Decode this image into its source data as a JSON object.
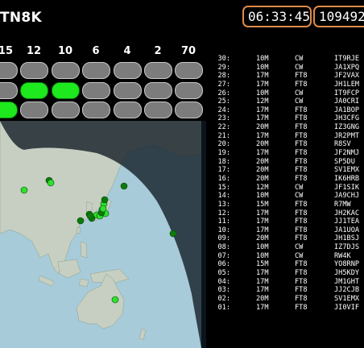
{
  "header": {
    "title": "TN8K",
    "time": "06:33:45",
    "serial": "109492"
  },
  "bands": {
    "labels": [
      "15",
      "12",
      "10",
      "6",
      "4",
      "2",
      "70"
    ],
    "rows": [
      [
        false,
        false,
        false,
        false,
        false,
        false,
        false
      ],
      [
        false,
        true,
        true,
        false,
        false,
        false,
        false
      ],
      [
        true,
        false,
        false,
        false,
        false,
        false,
        false
      ]
    ]
  },
  "colors": {
    "active": "#1ee81e",
    "inactive": "#7c7c7c",
    "accent": "#e08a4a",
    "land": "#c6cfc2",
    "water_day": "#a7cbd9",
    "water_night": "#304a57"
  },
  "map": {
    "markers": [
      {
        "shade": "light"
      },
      {
        "shade": "dark"
      },
      {
        "shade": "light"
      },
      {
        "shade": "dark"
      },
      {
        "shade": "light"
      },
      {
        "shade": "light"
      },
      {
        "shade": "dark"
      },
      {
        "shade": "light"
      },
      {
        "shade": "dark"
      },
      {
        "shade": "light"
      },
      {
        "shade": "dark"
      },
      {
        "shade": "dark"
      },
      {
        "shade": "light"
      },
      {
        "shade": "dark"
      },
      {
        "shade": "light"
      },
      {
        "shade": "dark"
      },
      {
        "shade": "dark"
      },
      {
        "shade": "light"
      }
    ]
  },
  "log": [
    {
      "num": "30:",
      "band": "10M",
      "mode": "CW",
      "call": "IT9RJE"
    },
    {
      "num": "29:",
      "band": "10M",
      "mode": "CW",
      "call": "JA1XPQ"
    },
    {
      "num": "28:",
      "band": "17M",
      "mode": "FT8",
      "call": "JF2VAX"
    },
    {
      "num": "27:",
      "band": "17M",
      "mode": "FT8",
      "call": "JH1LEM"
    },
    {
      "num": "26:",
      "band": "10M",
      "mode": "CW",
      "call": "IT9FCP"
    },
    {
      "num": "25:",
      "band": "12M",
      "mode": "CW",
      "call": "JA0CRI"
    },
    {
      "num": "24:",
      "band": "17M",
      "mode": "FT8",
      "call": "JA1BOP"
    },
    {
      "num": "23:",
      "band": "17M",
      "mode": "FT8",
      "call": "JH3CFG"
    },
    {
      "num": "22:",
      "band": "20M",
      "mode": "FT8",
      "call": "IZ3GNG"
    },
    {
      "num": "21:",
      "band": "17M",
      "mode": "FT8",
      "call": "JR2PMT"
    },
    {
      "num": "20:",
      "band": "20M",
      "mode": "FT8",
      "call": "R8SV"
    },
    {
      "num": "19:",
      "band": "17M",
      "mode": "FT8",
      "call": "JF2NMJ"
    },
    {
      "num": "18:",
      "band": "20M",
      "mode": "FT8",
      "call": "SP5DU"
    },
    {
      "num": "17:",
      "band": "20M",
      "mode": "FT8",
      "call": "SV1EMX"
    },
    {
      "num": "16:",
      "band": "20M",
      "mode": "FT8",
      "call": "IK6HRB"
    },
    {
      "num": "15:",
      "band": "12M",
      "mode": "CW",
      "call": "JF1SIK"
    },
    {
      "num": "14:",
      "band": "10M",
      "mode": "CW",
      "call": "JA9CHJ"
    },
    {
      "num": "13:",
      "band": "15M",
      "mode": "FT8",
      "call": "R7MW"
    },
    {
      "num": "12:",
      "band": "17M",
      "mode": "FT8",
      "call": "JH2KAC"
    },
    {
      "num": "11:",
      "band": "17M",
      "mode": "FT8",
      "call": "JJ1TEA"
    },
    {
      "num": "10:",
      "band": "17M",
      "mode": "FT8",
      "call": "JA1UOA"
    },
    {
      "num": "09:",
      "band": "20M",
      "mode": "FT8",
      "call": "JH1BSJ"
    },
    {
      "num": "08:",
      "band": "10M",
      "mode": "CW",
      "call": "IZ7DJS"
    },
    {
      "num": "07:",
      "band": "10M",
      "mode": "CW",
      "call": "RW4K"
    },
    {
      "num": "06:",
      "band": "15M",
      "mode": "FT8",
      "call": "YO8RNP"
    },
    {
      "num": "05:",
      "band": "17M",
      "mode": "FT8",
      "call": "JH5KDY"
    },
    {
      "num": "04:",
      "band": "17M",
      "mode": "FT8",
      "call": "JM1GHT"
    },
    {
      "num": "03:",
      "band": "17M",
      "mode": "FT8",
      "call": "JJ2CJB"
    },
    {
      "num": "02:",
      "band": "20M",
      "mode": "FT8",
      "call": "SV1EMX"
    },
    {
      "num": "01:",
      "band": "17M",
      "mode": "FT8",
      "call": "JI0VIF"
    }
  ]
}
